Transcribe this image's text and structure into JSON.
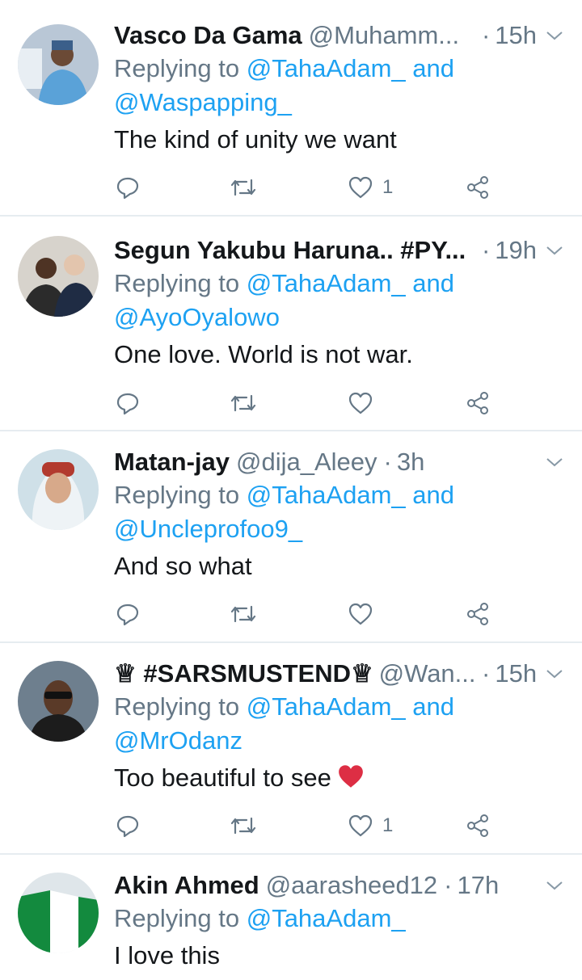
{
  "reply_prefix": "Replying to",
  "and_word": "and",
  "tweets": [
    {
      "name": "Vasco Da Gama",
      "handle": "@Muhamm...",
      "time": "15h",
      "reply_to_1": "@TahaAdam_",
      "reply_to_2": "@Waspapping_",
      "text": "The kind of unity we want",
      "likes": "1"
    },
    {
      "name": "Segun Yakubu Haruna.. #PY...",
      "handle": "",
      "time": "19h",
      "reply_to_1": "@TahaAdam_",
      "reply_to_2": "@AyoOyalowo",
      "text": "One love. World is not war.",
      "likes": ""
    },
    {
      "name": "Matan-jay",
      "handle": "@dija_Aleey",
      "time": "3h",
      "reply_to_1": "@TahaAdam_",
      "reply_to_2": "@Uncleprofoo9_",
      "text": "And so what",
      "likes": ""
    },
    {
      "name": "♕ #SARSMUSTEND♕",
      "handle": "@Wan...",
      "time": "15h",
      "reply_to_1": "@TahaAdam_",
      "reply_to_2": "@MrOdanz",
      "text": "Too beautiful to see",
      "likes": "1"
    },
    {
      "name": "Akin Ahmed",
      "handle": "@aarasheed12",
      "time": "17h",
      "reply_to_1": "@TahaAdam_",
      "reply_to_2": "",
      "text": "I love this",
      "likes": ""
    }
  ],
  "colors": {
    "link": "#1da1f2",
    "muted": "#657786",
    "text": "#14171a",
    "divider": "#e6ecf0"
  },
  "icons": [
    "reply-icon",
    "retweet-icon",
    "like-icon",
    "share-icon",
    "chevron-down-icon",
    "red-heart-emoji"
  ]
}
